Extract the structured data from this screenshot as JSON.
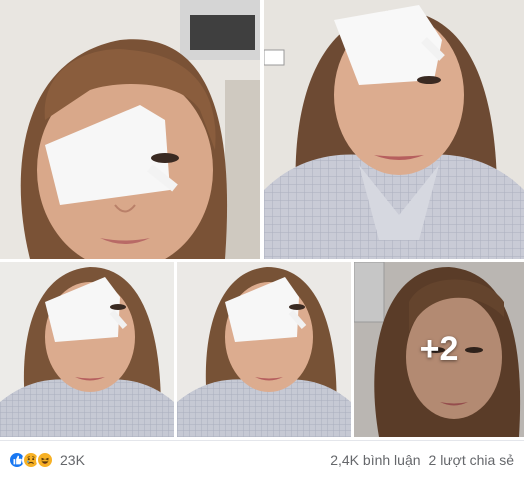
{
  "gallery": {
    "more_count": "+2"
  },
  "footer": {
    "reaction_icons": [
      "like-icon",
      "sad-icon",
      "haha-icon"
    ],
    "reaction_colors": {
      "like": "#1877f2",
      "sad": "#f7b125",
      "haha": "#f7b125"
    },
    "reaction_count": "23K",
    "comments": "2,4K bình luận",
    "shares": "2 lượt chia sẻ"
  }
}
